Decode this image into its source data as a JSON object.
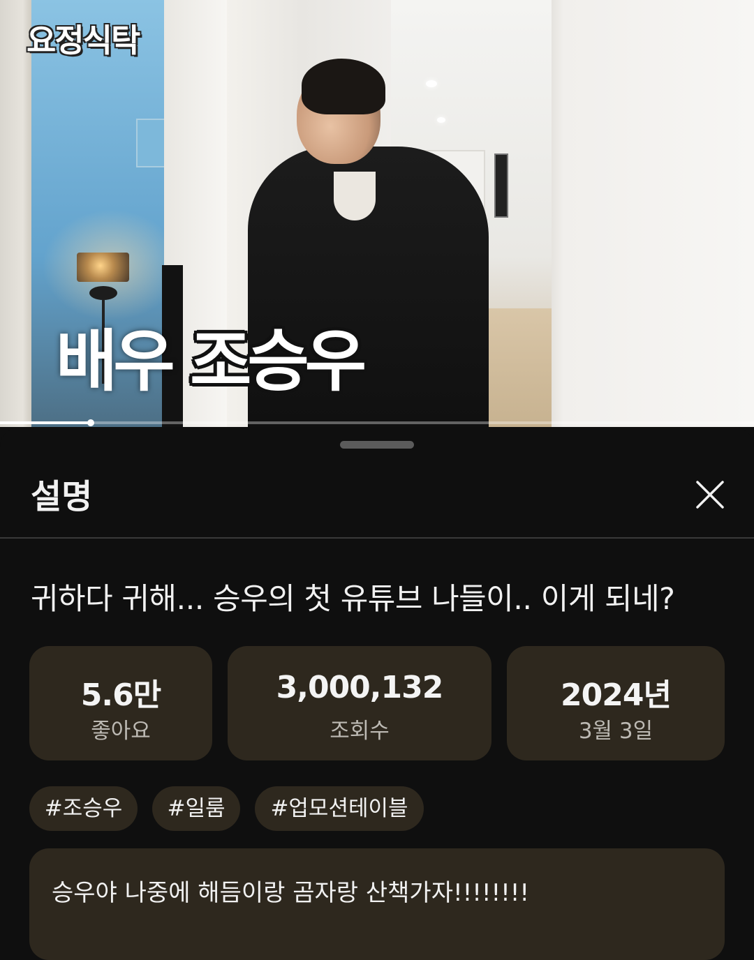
{
  "video": {
    "channel_logo_text": "요정식탁",
    "caption_part1": "배우",
    "caption_part2": "조승우",
    "progress_fraction": 0.12
  },
  "sheet": {
    "title": "설명",
    "close_icon": "close-icon"
  },
  "video_info": {
    "title": "귀하다 귀해... 승우의 첫 유튜브 나들이.. 이게 되네?",
    "stats": [
      {
        "value": "5.6만",
        "label": "좋아요"
      },
      {
        "value": "3,000,132",
        "label": "조회수"
      },
      {
        "value": "2024년",
        "label": "3월 3일"
      }
    ],
    "tags": [
      "#조승우",
      "#일룸",
      "#업모션테이블"
    ],
    "description": "승우야 나중에 해듬이랑 곰자랑 산책가자!!!!!!!!"
  },
  "colors": {
    "background": "#0f0f0f",
    "card": "#2e281e",
    "text_primary": "#f1f1f1",
    "text_secondary": "#bdbab4"
  }
}
